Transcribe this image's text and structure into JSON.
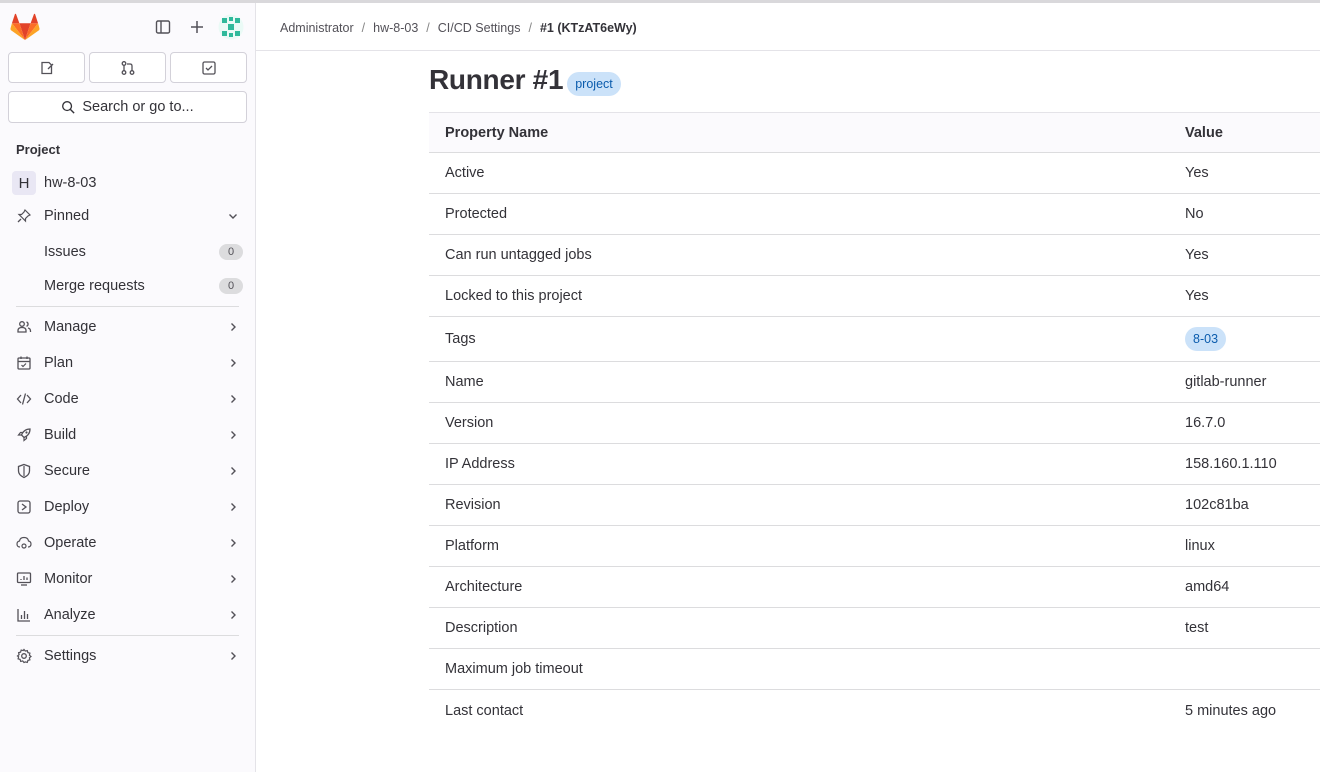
{
  "sidebar": {
    "search_label": "Search or go to...",
    "section_label": "Project",
    "project": {
      "initial": "H",
      "name": "hw-8-03"
    },
    "pinned_label": "Pinned",
    "issues": {
      "label": "Issues",
      "count": "0"
    },
    "merge_requests": {
      "label": "Merge requests",
      "count": "0"
    },
    "nav": [
      {
        "label": "Manage",
        "icon": "users-icon"
      },
      {
        "label": "Plan",
        "icon": "calendar-icon"
      },
      {
        "label": "Code",
        "icon": "code-icon"
      },
      {
        "label": "Build",
        "icon": "rocket-icon"
      },
      {
        "label": "Secure",
        "icon": "shield-icon"
      },
      {
        "label": "Deploy",
        "icon": "deploy-icon"
      },
      {
        "label": "Operate",
        "icon": "cloud-gear-icon"
      },
      {
        "label": "Monitor",
        "icon": "monitor-icon"
      },
      {
        "label": "Analyze",
        "icon": "chart-icon"
      }
    ],
    "settings_label": "Settings"
  },
  "breadcrumb": [
    "Administrator",
    "hw-8-03",
    "CI/CD Settings",
    "#1 (KTzAT6eWy)"
  ],
  "page": {
    "title": "Runner #1",
    "badge": "project"
  },
  "table": {
    "headers": [
      "Property Name",
      "Value"
    ],
    "rows": [
      {
        "name": "Active",
        "value": "Yes"
      },
      {
        "name": "Protected",
        "value": "No"
      },
      {
        "name": "Can run untagged jobs",
        "value": "Yes"
      },
      {
        "name": "Locked to this project",
        "value": "Yes"
      },
      {
        "name": "Tags",
        "value": "8-03"
      },
      {
        "name": "Name",
        "value": "gitlab-runner"
      },
      {
        "name": "Version",
        "value": "16.7.0"
      },
      {
        "name": "IP Address",
        "value": "158.160.1.110"
      },
      {
        "name": "Revision",
        "value": "102c81ba"
      },
      {
        "name": "Platform",
        "value": "linux"
      },
      {
        "name": "Architecture",
        "value": "amd64"
      },
      {
        "name": "Description",
        "value": "test"
      },
      {
        "name": "Maximum job timeout",
        "value": ""
      },
      {
        "name": "Last contact",
        "value": "5 minutes ago"
      }
    ]
  },
  "colors": {
    "brand_orange": "#e24329",
    "badge_bg": "#cbe2f9",
    "badge_text": "#0b5cad",
    "sidebar_bg": "#fbfafd"
  }
}
